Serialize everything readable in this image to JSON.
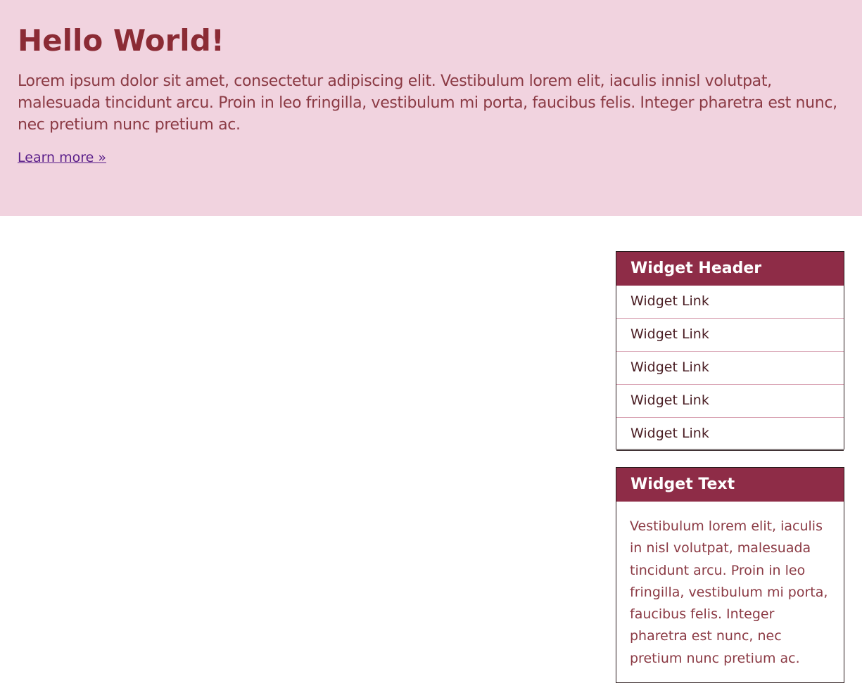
{
  "hero": {
    "title": "Hello World!",
    "body": "Lorem ipsum dolor sit amet, consectetur adipiscing elit. Vestibulum lorem elit, iaculis innisl volutpat, malesuada tincidunt arcu. Proin in leo fringilla, vestibulum mi porta, faucibus felis. Integer pharetra est nunc, nec pretium nunc pretium ac.",
    "link_label": "Learn more »"
  },
  "widget_links": {
    "header": "Widget Header",
    "items": [
      "Widget Link",
      "Widget Link",
      "Widget Link",
      "Widget Link",
      "Widget Link"
    ]
  },
  "widget_text": {
    "header": "Widget Text",
    "body": "Vestibulum lorem elit, iaculis in nisl volutpat, malesuada tincidunt arcu. Proin in leo fringilla, vestibulum mi porta, faucibus felis. Integer pharetra est nunc, nec pretium nunc pretium ac."
  },
  "colors": {
    "hero_background": "#f1d3df",
    "heading": "#8b2b35",
    "widget_header_background": "#8e2c47",
    "link": "#5a1e8a"
  }
}
